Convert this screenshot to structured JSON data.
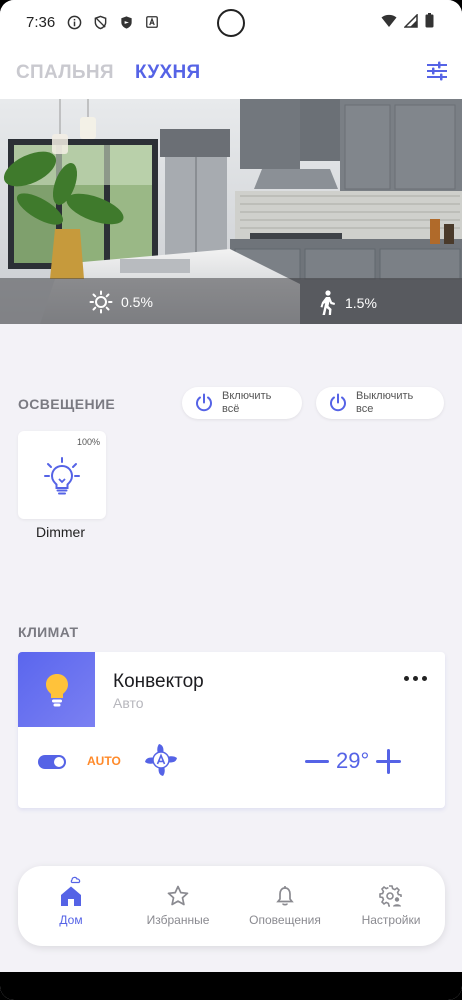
{
  "status_bar": {
    "time": "7:36"
  },
  "tabs": [
    {
      "label": "СПАЛЬНЯ",
      "active": false
    },
    {
      "label": "КУХНЯ",
      "active": true
    }
  ],
  "hero": {
    "light_value": "0.5%",
    "motion_value": "1.5%"
  },
  "lighting": {
    "title": "ОСВЕЩЕНИЕ",
    "on_all_line1": "Включить",
    "on_all_line2": "всё",
    "off_all_line1": "Выключить",
    "off_all_line2": "все",
    "device": {
      "name": "Dimmer",
      "level": "100%"
    }
  },
  "climate": {
    "title": "КЛИМАТ",
    "device": {
      "name": "Конвектор",
      "mode": "Авто",
      "mode_badge": "AUTO",
      "temperature": "29°",
      "power_on": true
    }
  },
  "bottom_nav": [
    {
      "label": "Дом",
      "icon": "home-icon",
      "active": true
    },
    {
      "label": "Избранные",
      "icon": "star-icon",
      "active": false
    },
    {
      "label": "Оповещения",
      "icon": "bell-icon",
      "active": false
    },
    {
      "label": "Настройки",
      "icon": "settings-user-icon",
      "active": false
    }
  ],
  "colors": {
    "accent": "#5563e6",
    "auto_orange": "#ff8a2a",
    "background": "#f3f2f7"
  }
}
